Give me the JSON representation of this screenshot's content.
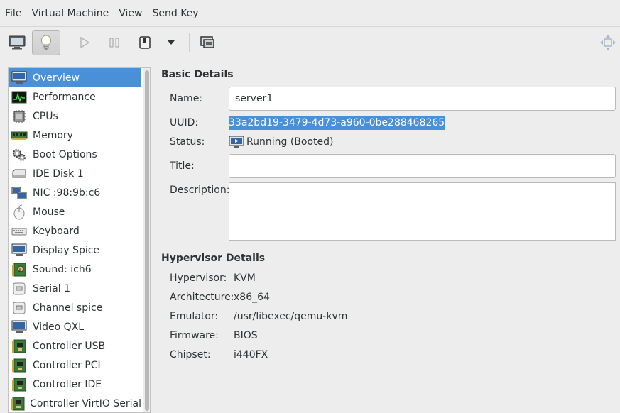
{
  "menubar": {
    "items": [
      "File",
      "Virtual Machine",
      "View",
      "Send Key"
    ]
  },
  "toolbar": {
    "icons": [
      "console-icon",
      "details-icon",
      "run-icon",
      "pause-icon",
      "shutdown-icon",
      "shutdown-menu-icon",
      "snapshot-icon",
      "fullscreen-icon"
    ]
  },
  "sidebar": {
    "items": [
      {
        "label": "Overview",
        "icon": "overview-icon"
      },
      {
        "label": "Performance",
        "icon": "performance-icon"
      },
      {
        "label": "CPUs",
        "icon": "cpu-icon"
      },
      {
        "label": "Memory",
        "icon": "memory-icon"
      },
      {
        "label": "Boot Options",
        "icon": "boot-options-icon"
      },
      {
        "label": "IDE Disk 1",
        "icon": "disk-icon"
      },
      {
        "label": "NIC :98:9b:c6",
        "icon": "nic-icon"
      },
      {
        "label": "Mouse",
        "icon": "mouse-icon"
      },
      {
        "label": "Keyboard",
        "icon": "keyboard-icon"
      },
      {
        "label": "Display Spice",
        "icon": "display-icon"
      },
      {
        "label": "Sound: ich6",
        "icon": "sound-icon"
      },
      {
        "label": "Serial 1",
        "icon": "serial-icon"
      },
      {
        "label": "Channel spice",
        "icon": "channel-icon"
      },
      {
        "label": "Video QXL",
        "icon": "video-icon"
      },
      {
        "label": "Controller USB",
        "icon": "controller-icon"
      },
      {
        "label": "Controller PCI",
        "icon": "controller-icon"
      },
      {
        "label": "Controller IDE",
        "icon": "controller-icon"
      },
      {
        "label": "Controller VirtIO Serial",
        "icon": "controller-icon"
      }
    ]
  },
  "basic": {
    "title": "Basic Details",
    "name_label": "Name:",
    "name_value": "server1",
    "uuid_label": "UUID:",
    "uuid_value": "33a2bd19-3479-4d73-a960-0be288468265",
    "status_label": "Status:",
    "status_value": "Running (Booted)",
    "title_label": "Title:",
    "title_value": "",
    "description_label": "Description:",
    "description_value": ""
  },
  "hypervisor": {
    "title": "Hypervisor Details",
    "hypervisor_label": "Hypervisor:",
    "hypervisor_value": "KVM",
    "arch_label": "Architecture:",
    "arch_value": "x86_64",
    "emulator_label": "Emulator:",
    "emulator_value": "/usr/libexec/qemu-kvm",
    "firmware_label": "Firmware:",
    "firmware_value": "BIOS",
    "chipset_label": "Chipset:",
    "chipset_value": "i440FX"
  },
  "colors": {
    "selection": "#4a90d9",
    "window_bg": "#ededed"
  }
}
